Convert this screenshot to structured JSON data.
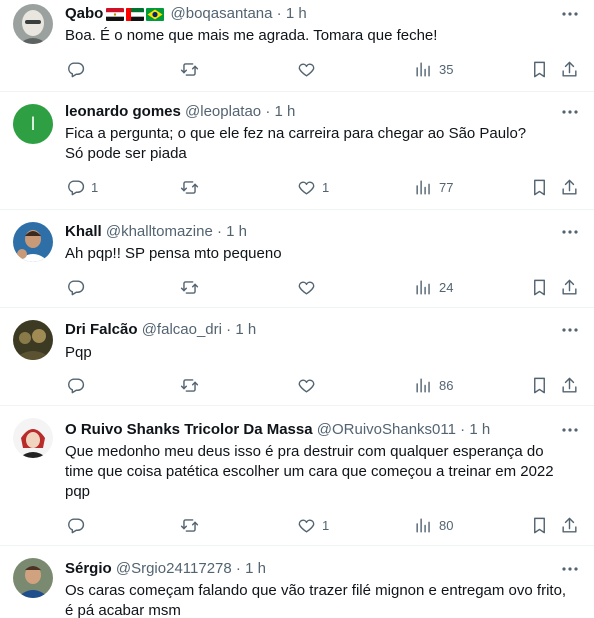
{
  "tweets": [
    {
      "name": "Qabo",
      "flags": [
        "egypt-flag",
        "uae-flag",
        "brazil-flag"
      ],
      "handle": "@boqasantana",
      "time": "1 h",
      "text": "Boa. É o nome que mais me agrada. Tomara que feche!",
      "replies": "",
      "likes": "",
      "views": "35",
      "avatar": "person-icon"
    },
    {
      "name": "leonardo gomes",
      "handle": "@leoplatao",
      "time": "1 h",
      "text": "Fica a pergunta; o que ele fez na carreira para chegar ao São Paulo?\nSó pode ser piada",
      "replies": "1",
      "likes": "1",
      "views": "77",
      "avatar_letter": "l",
      "avatar_color": "#2ea043"
    },
    {
      "name": "Khall",
      "handle": "@khalltomazine",
      "time": "1 h",
      "text": "Ah pqp!! SP pensa mto pequeno",
      "replies": "",
      "likes": "",
      "views": "24",
      "avatar": "person-icon"
    },
    {
      "name": "Dri Falcão",
      "handle": "@falcao_dri",
      "time": "1 h",
      "text": "Pqp",
      "replies": "",
      "likes": "",
      "views": "86",
      "avatar": "group-photo-icon"
    },
    {
      "name": "O Ruivo Shanks Tricolor Da Massa",
      "handle": "@ORuivoShanks011",
      "time": "1 h",
      "text": "Que medonho meu deus isso é pra destruir com qualquer esperança do\ntime que coisa patética escolher um cara que começou a treinar em 2022\npqp",
      "replies": "",
      "likes": "1",
      "views": "80",
      "avatar": "anime-character-icon"
    },
    {
      "name": "Sérgio",
      "handle": "@Srgio24117278",
      "time": "1 h",
      "text": "Os caras começam falando que vão trazer filé mignon e entregam ovo frito,\né pá acabar msm",
      "replies": "",
      "likes": "",
      "views": "",
      "avatar": "person-icon"
    }
  ],
  "dot": "·",
  "colors": {
    "text": "#0f1419",
    "secondary": "#536471",
    "border": "#eff3f4"
  }
}
